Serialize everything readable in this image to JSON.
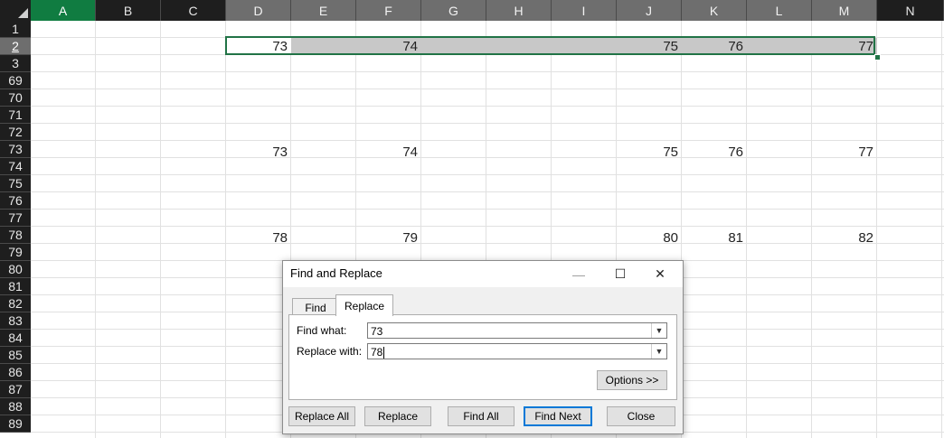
{
  "columns": [
    "A",
    "B",
    "C",
    "D",
    "E",
    "F",
    "G",
    "H",
    "I",
    "J",
    "K",
    "L",
    "M",
    "N"
  ],
  "rows": [
    "1",
    "2",
    "3",
    "69",
    "70",
    "71",
    "72",
    "73",
    "74",
    "75",
    "76",
    "77",
    "78",
    "79",
    "80",
    "81",
    "82",
    "83",
    "84",
    "85",
    "86",
    "87",
    "88",
    "89"
  ],
  "cells": {
    "row2": {
      "D": "73",
      "F": "74",
      "J": "75",
      "K": "76",
      "M": "77"
    },
    "row73": {
      "D": "73",
      "F": "74",
      "J": "75",
      "K": "76",
      "M": "77"
    },
    "row78": {
      "D": "78",
      "F": "79",
      "J": "80",
      "K": "81",
      "M": "82"
    }
  },
  "dialog": {
    "title": "Find and Replace",
    "minimize_icon": "—",
    "maximize_icon": "☐",
    "close_icon": "✕",
    "tabs": [
      "Find",
      "Replace"
    ],
    "active_tab": "Replace",
    "find_label": "Find what:",
    "find_value": "73",
    "replace_label": "Replace with:",
    "replace_value": "78",
    "options_button": "Options >>",
    "buttons": [
      "Replace All",
      "Replace",
      "Find All",
      "Find Next",
      "Close"
    ]
  },
  "colors": {
    "selection_border": "#217346",
    "active_header": "#107c41",
    "default_button": "#0078d7"
  }
}
